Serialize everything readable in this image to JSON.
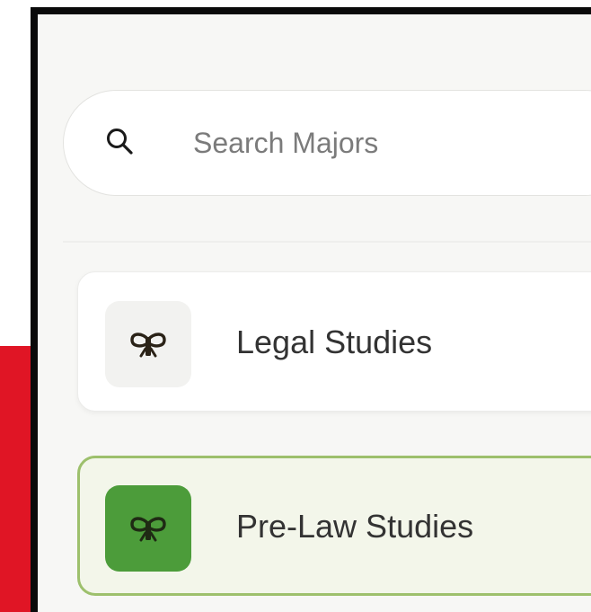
{
  "search": {
    "placeholder": "Search Majors",
    "value": ""
  },
  "majors": [
    {
      "label": "Legal Studies",
      "icon": "ribbon-bow-icon",
      "selected": false
    },
    {
      "label": "Pre-Law Studies",
      "icon": "ribbon-bow-icon",
      "selected": true
    }
  ],
  "colors": {
    "accent_red": "#e01525",
    "selected_green": "#4c9c3a",
    "selected_border": "#9dc06c",
    "selected_bg": "#f3f6ea"
  }
}
